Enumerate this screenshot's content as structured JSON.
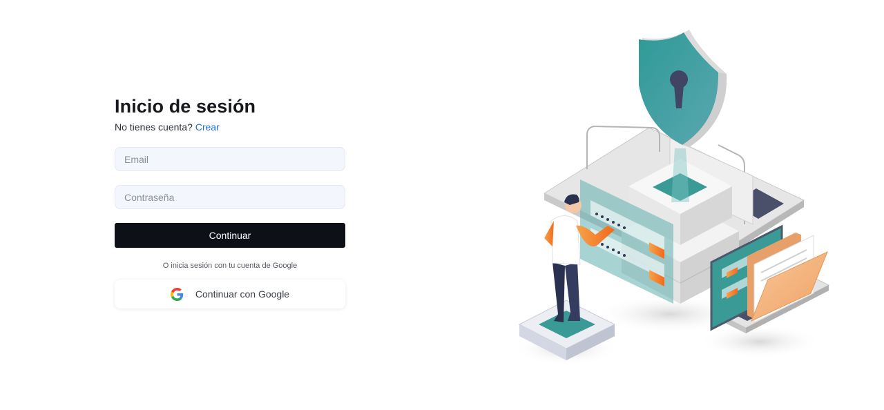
{
  "login": {
    "title": "Inicio de sesión",
    "signup_prompt": "No tienes cuenta?",
    "signup_link": "Crear",
    "email_placeholder": "Email",
    "password_placeholder": "Contraseña",
    "continue_label": "Continuar",
    "google_divider": "O inicia sesión con tu cuenta de Google",
    "google_button_label": "Continuar con Google"
  },
  "colors": {
    "primary_button": "#0d1117",
    "link": "#1f6fd6",
    "input_background": "#f3f6fd",
    "illustration_teal": "#3a9a96",
    "illustration_orange": "#f07a22"
  },
  "icons": {
    "google": "google-icon"
  }
}
